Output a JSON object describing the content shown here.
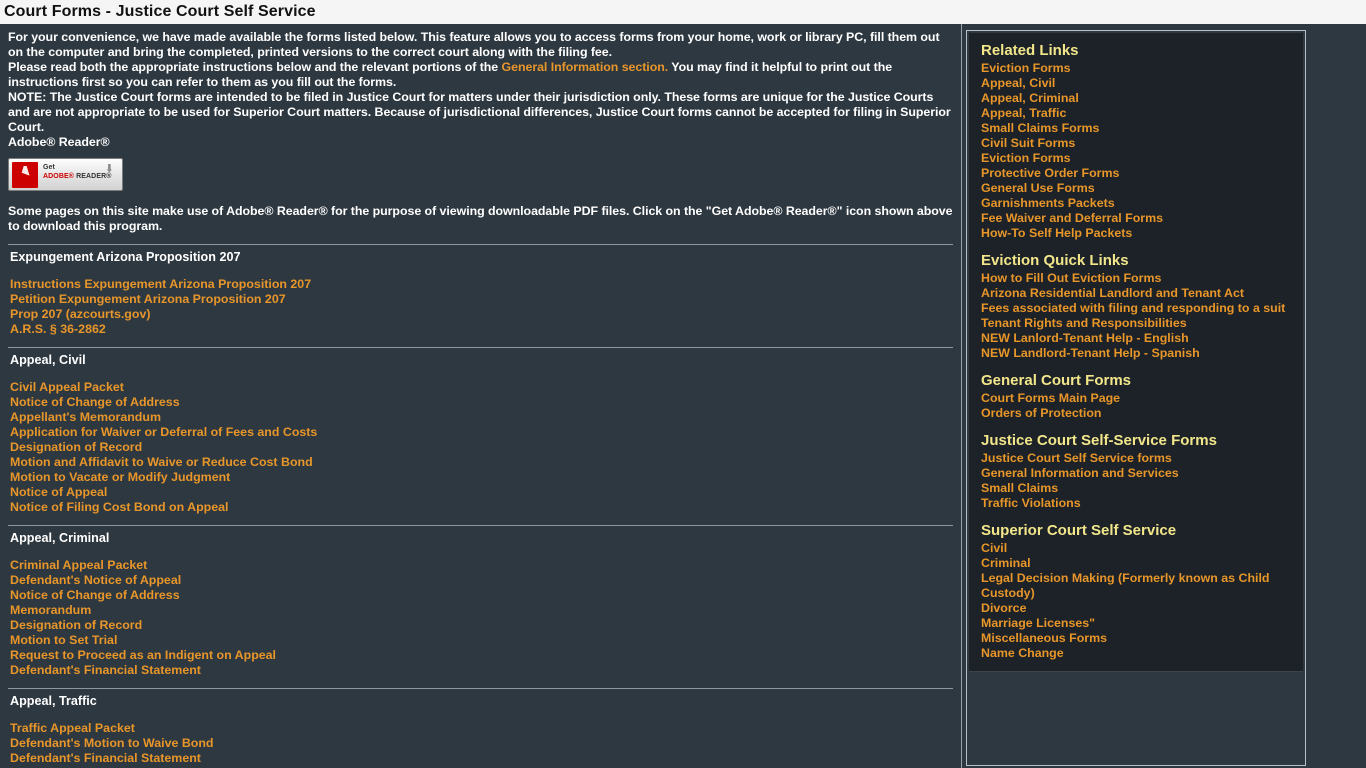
{
  "window": {
    "title": "Court Forms - Justice Court Self Service"
  },
  "colors": {
    "page_bg": "#2e3840",
    "panel_bg": "#1c2227",
    "link": "#e8962a",
    "heading": "#f2e68b",
    "body_text": "#ffffff",
    "titlebar_bg": "#f5f5f5"
  },
  "main": {
    "intro": {
      "p1_a": "For your convenience, we have made available the forms listed below. This feature allows you to access forms from your home, work or library PC, fill them out on the computer and bring the completed, printed versions to the correct court along with the filing fee.",
      "p2_a": "Please read both the appropriate instructions below and the relevant portions of the ",
      "p2_link": "General Information section.",
      "p2_b": " You may find it helpful to print out the instructions first so you can refer to them as you fill out the forms.",
      "p3": "NOTE: The Justice Court forms are intended to be filed in Justice Court for matters under their jurisdiction only. These forms are unique for the Justice Courts and are not appropriate to be used for Superior Court matters. Because of jurisdictional differences, Justice Court forms cannot be accepted for filing in Superior Court.",
      "p4": "Adobe® Reader®"
    },
    "adobe": {
      "get_label": "Get",
      "brand_label": "ADOBE®",
      "reader_label": " READER®",
      "download_arrow": "⬇",
      "note": "Some pages on this site make use of Adobe® Reader® for the purpose of viewing downloadable PDF files. Click on the \"Get Adobe® Reader®\" icon shown above to download this program."
    },
    "sections": [
      {
        "title": "Expungement Arizona Proposition 207",
        "links": [
          "Instructions Expungement Arizona Proposition 207",
          "Petition Expungement Arizona Proposition 207",
          "Prop 207 (azcourts.gov)",
          "A.R.S. § 36-2862"
        ]
      },
      {
        "title": "Appeal, Civil",
        "links": [
          "Civil Appeal Packet",
          "Notice of Change of Address",
          "Appellant's Memorandum",
          "Application for Waiver or Deferral of Fees and Costs",
          "Designation of Record",
          "Motion and Affidavit to Waive or Reduce Cost Bond",
          "Motion to Vacate or Modify Judgment",
          "Notice of Appeal",
          "Notice of Filing Cost Bond on Appeal"
        ]
      },
      {
        "title": "Appeal, Criminal",
        "links": [
          "Criminal Appeal Packet",
          "Defendant's Notice of Appeal",
          "Notice of Change of Address",
          "Memorandum",
          "Designation of Record",
          "Motion to Set Trial",
          "Request to Proceed as an Indigent on Appeal",
          "Defendant's Financial Statement"
        ]
      },
      {
        "title": "Appeal, Traffic",
        "links": [
          "Traffic Appeal Packet",
          "Defendant's Motion to Waive Bond",
          "Defendant's Financial Statement"
        ]
      }
    ]
  },
  "sidebar": {
    "groups": [
      {
        "heading": "Related Links",
        "links": [
          "Eviction Forms",
          "Appeal, Civil",
          "Appeal, Criminal",
          "Appeal, Traffic",
          "Small Claims Forms",
          "Civil Suit Forms",
          "Eviction Forms",
          "Protective Order Forms",
          "General Use Forms",
          "Garnishments Packets",
          "Fee Waiver and Deferral Forms",
          "How-To Self Help Packets"
        ]
      },
      {
        "heading": "Eviction Quick Links",
        "links": [
          "How to Fill Out Eviction Forms",
          "Arizona Residential Landlord and Tenant Act",
          "Fees associated with filing and responding to a suit",
          "Tenant Rights and Responsibilities",
          "NEW Lanlord-Tenant Help - English",
          "NEW Landlord-Tenant Help - Spanish"
        ]
      },
      {
        "heading": "General Court Forms",
        "links": [
          "Court Forms Main Page",
          "Orders of Protection"
        ]
      },
      {
        "heading": "Justice Court Self-Service Forms",
        "links": [
          "Justice Court Self Service forms",
          "General Information and Services",
          "Small Claims",
          "Traffic Violations"
        ]
      },
      {
        "heading": "Superior Court Self Service",
        "links": [
          "Civil",
          "Criminal",
          "Legal Decision Making (Formerly known as Child Custody)",
          "Divorce",
          "Marriage Licenses\"",
          "Miscellaneous Forms",
          "Name Change"
        ]
      }
    ]
  }
}
